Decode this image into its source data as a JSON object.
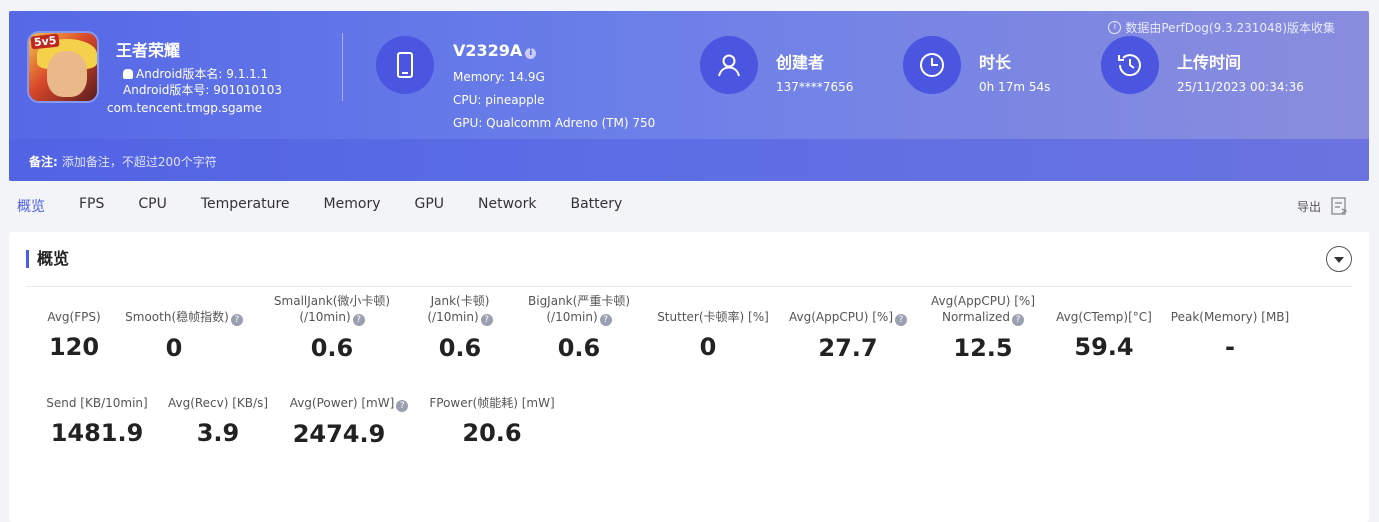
{
  "app": {
    "name": "王者荣耀",
    "version_name": "Android版本名: 9.1.1.1",
    "version_code": "Android版本号: 901010103",
    "package": "com.tencent.tmgp.sgame",
    "icon_badge": "5v5"
  },
  "source_text": "数据由PerfDog(9.3.231048)版本收集",
  "device": {
    "model": "V2329A",
    "memory": "Memory: 14.9G",
    "cpu": "CPU: pineapple",
    "gpu": "GPU: Qualcomm Adreno (TM) 750"
  },
  "creator": {
    "title": "创建者",
    "value": "137****7656"
  },
  "duration": {
    "title": "时长",
    "value": "0h 17m 54s"
  },
  "upload": {
    "title": "上传时间",
    "value": "25/11/2023 00:34:36"
  },
  "note": {
    "label": "备注:",
    "placeholder": "添加备注，不超过200个字符"
  },
  "tabs": [
    "概览",
    "FPS",
    "CPU",
    "Temperature",
    "Memory",
    "GPU",
    "Network",
    "Battery"
  ],
  "export_label": "导出",
  "overview": {
    "title": "概览",
    "row1": [
      {
        "label": "Avg(FPS)",
        "value": "120"
      },
      {
        "label": "Smooth(稳帧指数)",
        "value": "0"
      },
      {
        "label1": "SmallJank(微小卡顿)",
        "label2": "(/10min)",
        "value": "0.6"
      },
      {
        "label1": "Jank(卡顿)",
        "label2": "(/10min)",
        "value": "0.6"
      },
      {
        "label1": "BigJank(严重卡顿)",
        "label2": "(/10min)",
        "value": "0.6"
      },
      {
        "label": "Stutter(卡顿率) [%]",
        "value": "0"
      },
      {
        "label": "Avg(AppCPU) [%]",
        "value": "27.7"
      },
      {
        "label1": "Avg(AppCPU) [%]",
        "label2": "Normalized",
        "value": "12.5"
      },
      {
        "label": "Avg(CTemp)[°C]",
        "value": "59.4"
      },
      {
        "label": "Peak(Memory) [MB]",
        "value": "-"
      }
    ],
    "row2": [
      {
        "label": "Send [KB/10min]",
        "value": "1481.9"
      },
      {
        "label": "Avg(Recv) [KB/s]",
        "value": "3.9"
      },
      {
        "label": "Avg(Power) [mW]",
        "value": "2474.9"
      },
      {
        "label": "FPower(帧能耗) [mW]",
        "value": "20.6"
      }
    ]
  }
}
